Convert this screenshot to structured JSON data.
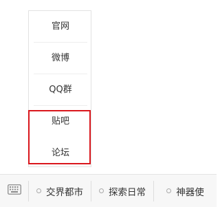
{
  "menu": {
    "items": [
      {
        "label": "官网"
      },
      {
        "label": "微博"
      },
      {
        "label": "QQ群"
      },
      {
        "label": "贴吧"
      },
      {
        "label": "论坛"
      }
    ],
    "highlight_color": "#d9161c"
  },
  "bottom_bar": {
    "keyboard_icon": "keyboard-icon",
    "tabs": [
      {
        "label": "交界都市",
        "icon": "circle-dot-icon"
      },
      {
        "label": "探索日常",
        "icon": "circle-dot-icon"
      },
      {
        "label": "神器使",
        "icon": "circle-dot-icon"
      }
    ]
  }
}
